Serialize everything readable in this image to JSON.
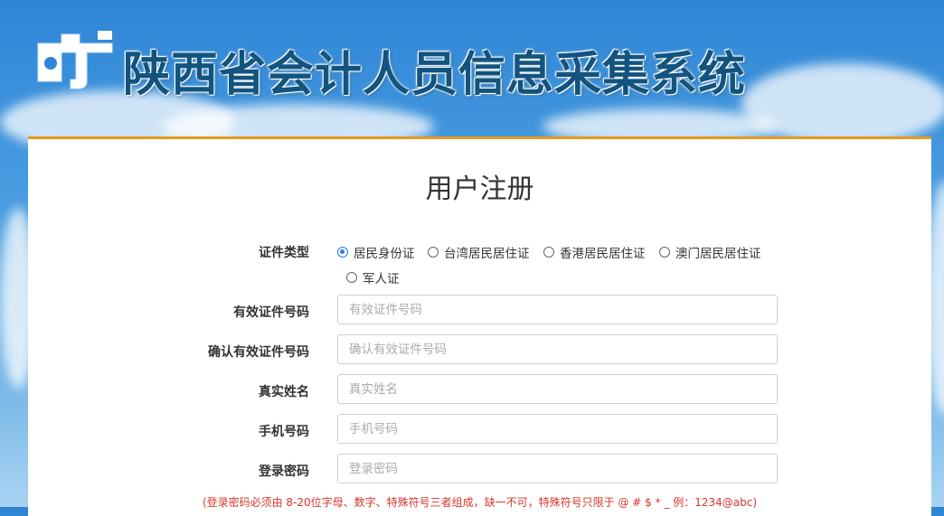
{
  "header": {
    "title": "陕西省会计人员信息采集系统"
  },
  "form": {
    "title": "用户注册",
    "id_type": {
      "label": "证件类型",
      "options": [
        "居民身份证",
        "台湾居民居住证",
        "香港居民居住证",
        "澳门居民居住证",
        "军人证"
      ],
      "selected": "居民身份证"
    },
    "id_number": {
      "label": "有效证件号码",
      "placeholder": "有效证件号码",
      "value": ""
    },
    "id_number_confirm": {
      "label": "确认有效证件号码",
      "placeholder": "确认有效证件号码",
      "value": ""
    },
    "real_name": {
      "label": "真实姓名",
      "placeholder": "真实姓名",
      "value": ""
    },
    "phone": {
      "label": "手机号码",
      "placeholder": "手机号码",
      "value": ""
    },
    "password": {
      "label": "登录密码",
      "placeholder": "登录密码",
      "value": ""
    },
    "password_hint": "(登录密码必须由 8-20位字母、数字、特殊符号三者组成，缺一不可，特殊符号只限于 @ # $ * _ 例：1234@abc)"
  },
  "colors": {
    "accent": "#e89a1b",
    "title_text": "#12547f",
    "radio_selected": "#2a7ce0",
    "hint_text": "#d8362b"
  },
  "icons": {
    "logo": "provincial-accounting-logo-icon"
  }
}
